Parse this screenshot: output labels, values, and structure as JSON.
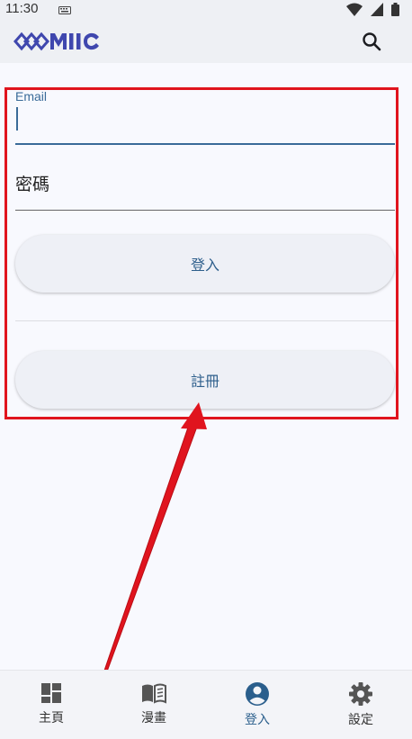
{
  "status_bar": {
    "time": "11:30"
  },
  "app": {
    "brand_color": "#3f47ae",
    "accent_color": "#3a6b99"
  },
  "login_form": {
    "email_label": "Email",
    "email_value": "",
    "password_label": "密碼",
    "login_label": "登入",
    "register_label": "註冊"
  },
  "bottom_nav": {
    "items": [
      {
        "label": "主頁",
        "icon": "dashboard-icon"
      },
      {
        "label": "漫畫",
        "icon": "book-icon"
      },
      {
        "label": "登入",
        "icon": "account-circle-icon",
        "active": true
      },
      {
        "label": "設定",
        "icon": "gear-icon"
      }
    ]
  },
  "annotation": {
    "color": "#e0141e"
  }
}
